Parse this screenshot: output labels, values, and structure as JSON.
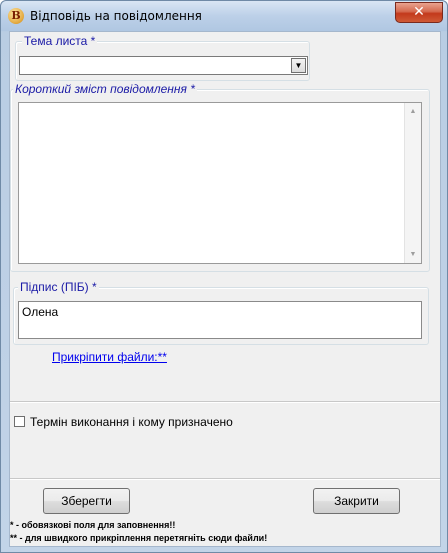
{
  "window": {
    "title": "Відповідь на повідомлення",
    "app_icon_letter": "B",
    "close_glyph": "✕"
  },
  "form": {
    "topic": {
      "label": "Тема листа *",
      "value": ""
    },
    "summary": {
      "label": "Короткий зміст повідомлення *",
      "value": ""
    },
    "signature": {
      "label": "Підпис (ПІБ) *",
      "value": "Олена"
    },
    "attach_link": "Прикріпити файли:**",
    "deadline_checkbox": {
      "label": "Термін виконання і кому призначено",
      "checked": false
    }
  },
  "buttons": {
    "save": "Зберегти",
    "close": "Закрити"
  },
  "notes": {
    "required": "* - обовязкові поля для заповнення!!",
    "drag": "** - для швидкого прикріплення перетягніть сюди файли!"
  },
  "icons": {
    "combo_arrow": "dropdown-arrow-icon",
    "scroll_up": "scroll-up-icon",
    "scroll_down": "scroll-down-icon"
  }
}
